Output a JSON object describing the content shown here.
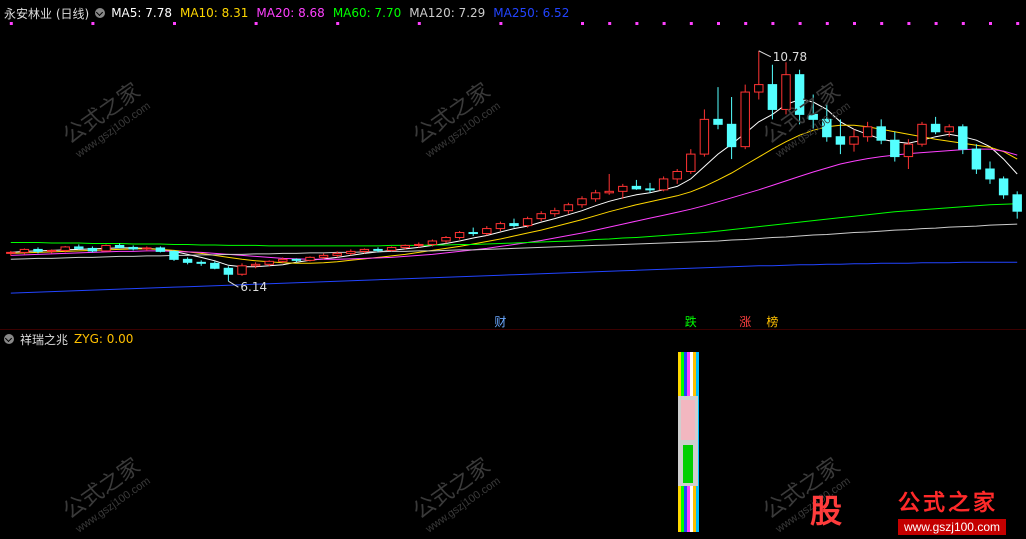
{
  "top_legend": {
    "title": "永安林业 (日线)",
    "items": [
      {
        "label": "MA5: 7.78",
        "color": "#ffffff"
      },
      {
        "label": "MA10: 8.31",
        "color": "#ffd700"
      },
      {
        "label": "MA20: 8.68",
        "color": "#ff40ff"
      },
      {
        "label": "MA60: 7.70",
        "color": "#00ff00"
      },
      {
        "label": "MA120: 7.29",
        "color": "#cccccc"
      },
      {
        "label": "MA250: 6.52",
        "color": "#2244ff"
      }
    ]
  },
  "sub_legend": {
    "title": "祥瑞之兆",
    "value_label": "ZYG: 0.00",
    "value_color": "#ffc000"
  },
  "annotations": {
    "high": "10.78",
    "low": "6.14",
    "markers": [
      {
        "text": "财",
        "color": "#6aa8ff"
      },
      {
        "text": "跌",
        "color": "#00ff00"
      },
      {
        "text": "涨",
        "color": "#ff4040"
      },
      {
        "text": "榜",
        "color": "#ffc000"
      }
    ]
  },
  "watermark": {
    "text": "公式之家",
    "url": "www.gszj100.com"
  },
  "logo": {
    "badge": "股",
    "name": "公式之家",
    "url": "www.gszj100.com"
  },
  "colors": {
    "up": "#ff3333",
    "down": "#54ffff"
  },
  "chart_data": {
    "type": "candlestick",
    "ylim": [
      5.6,
      11.2
    ],
    "candles": [
      [
        6.7,
        6.75,
        6.65,
        6.72
      ],
      [
        6.72,
        6.8,
        6.68,
        6.78
      ],
      [
        6.78,
        6.82,
        6.7,
        6.74
      ],
      [
        6.74,
        6.78,
        6.7,
        6.76
      ],
      [
        6.76,
        6.85,
        6.72,
        6.83
      ],
      [
        6.83,
        6.88,
        6.78,
        6.8
      ],
      [
        6.8,
        6.84,
        6.72,
        6.75
      ],
      [
        6.75,
        6.88,
        6.74,
        6.86
      ],
      [
        6.86,
        6.9,
        6.8,
        6.82
      ],
      [
        6.82,
        6.86,
        6.76,
        6.79
      ],
      [
        6.79,
        6.84,
        6.75,
        6.81
      ],
      [
        6.81,
        6.84,
        6.72,
        6.74
      ],
      [
        6.74,
        6.76,
        6.55,
        6.58
      ],
      [
        6.58,
        6.62,
        6.48,
        6.52
      ],
      [
        6.52,
        6.56,
        6.45,
        6.5
      ],
      [
        6.5,
        6.54,
        6.38,
        6.4
      ],
      [
        6.4,
        6.44,
        6.14,
        6.28
      ],
      [
        6.28,
        6.5,
        6.25,
        6.45
      ],
      [
        6.45,
        6.52,
        6.4,
        6.48
      ],
      [
        6.48,
        6.56,
        6.44,
        6.54
      ],
      [
        6.54,
        6.62,
        6.5,
        6.58
      ],
      [
        6.58,
        6.6,
        6.52,
        6.56
      ],
      [
        6.56,
        6.64,
        6.54,
        6.62
      ],
      [
        6.62,
        6.7,
        6.58,
        6.66
      ],
      [
        6.66,
        6.74,
        6.62,
        6.7
      ],
      [
        6.7,
        6.78,
        6.66,
        6.74
      ],
      [
        6.74,
        6.8,
        6.7,
        6.78
      ],
      [
        6.78,
        6.82,
        6.72,
        6.76
      ],
      [
        6.76,
        6.84,
        6.74,
        6.82
      ],
      [
        6.82,
        6.88,
        6.78,
        6.86
      ],
      [
        6.86,
        6.92,
        6.82,
        6.88
      ],
      [
        6.88,
        6.98,
        6.84,
        6.95
      ],
      [
        6.95,
        7.05,
        6.9,
        7.02
      ],
      [
        7.02,
        7.15,
        6.98,
        7.12
      ],
      [
        7.12,
        7.22,
        7.05,
        7.1
      ],
      [
        7.1,
        7.25,
        7.06,
        7.2
      ],
      [
        7.2,
        7.34,
        7.15,
        7.3
      ],
      [
        7.3,
        7.4,
        7.22,
        7.26
      ],
      [
        7.26,
        7.44,
        7.22,
        7.4
      ],
      [
        7.4,
        7.55,
        7.35,
        7.5
      ],
      [
        7.5,
        7.62,
        7.44,
        7.56
      ],
      [
        7.56,
        7.72,
        7.5,
        7.68
      ],
      [
        7.68,
        7.85,
        7.62,
        7.8
      ],
      [
        7.8,
        7.98,
        7.74,
        7.92
      ],
      [
        7.92,
        8.3,
        7.88,
        7.95
      ],
      [
        7.95,
        8.1,
        7.8,
        8.05
      ],
      [
        8.05,
        8.18,
        7.98,
        8.0
      ],
      [
        8.0,
        8.12,
        7.92,
        7.98
      ],
      [
        7.98,
        8.25,
        7.95,
        8.2
      ],
      [
        8.2,
        8.4,
        8.1,
        8.35
      ],
      [
        8.35,
        8.8,
        8.3,
        8.7
      ],
      [
        8.7,
        9.6,
        8.65,
        9.4
      ],
      [
        9.4,
        10.05,
        9.2,
        9.3
      ],
      [
        9.3,
        9.85,
        8.6,
        8.85
      ],
      [
        8.85,
        10.1,
        8.8,
        9.95
      ],
      [
        9.95,
        10.78,
        9.8,
        10.1
      ],
      [
        10.1,
        10.5,
        9.4,
        9.6
      ],
      [
        9.6,
        10.55,
        9.5,
        10.3
      ],
      [
        10.3,
        10.4,
        9.3,
        9.5
      ],
      [
        9.5,
        9.9,
        9.2,
        9.4
      ],
      [
        9.4,
        9.7,
        8.95,
        9.05
      ],
      [
        9.05,
        9.4,
        8.7,
        8.9
      ],
      [
        8.9,
        9.2,
        8.75,
        9.05
      ],
      [
        9.05,
        9.35,
        8.95,
        9.25
      ],
      [
        9.25,
        9.4,
        8.9,
        8.98
      ],
      [
        8.98,
        9.15,
        8.55,
        8.65
      ],
      [
        8.65,
        9.0,
        8.4,
        8.9
      ],
      [
        8.9,
        9.35,
        8.85,
        9.3
      ],
      [
        9.3,
        9.45,
        9.1,
        9.15
      ],
      [
        9.15,
        9.3,
        9.05,
        9.25
      ],
      [
        9.25,
        9.3,
        8.7,
        8.8
      ],
      [
        8.8,
        8.9,
        8.3,
        8.4
      ],
      [
        8.4,
        8.55,
        8.1,
        8.2
      ],
      [
        8.2,
        8.25,
        7.8,
        7.88
      ],
      [
        7.88,
        7.95,
        7.4,
        7.55
      ]
    ],
    "series": [
      {
        "name": "MA5",
        "color": "#ffffff",
        "values": [
          6.72,
          6.74,
          6.75,
          6.76,
          6.77,
          6.78,
          6.79,
          6.8,
          6.81,
          6.81,
          6.8,
          6.78,
          6.74,
          6.68,
          6.62,
          6.55,
          6.46,
          6.43,
          6.43,
          6.45,
          6.47,
          6.52,
          6.56,
          6.59,
          6.62,
          6.66,
          6.7,
          6.73,
          6.76,
          6.79,
          6.82,
          6.86,
          6.9,
          6.95,
          7.01,
          7.06,
          7.13,
          7.2,
          7.25,
          7.33,
          7.4,
          7.48,
          7.56,
          7.66,
          7.75,
          7.82,
          7.88,
          7.92,
          7.98,
          8.05,
          8.2,
          8.45,
          8.7,
          8.9,
          9.12,
          9.35,
          9.5,
          9.7,
          9.8,
          9.75,
          9.6,
          9.35,
          9.2,
          9.1,
          9.0,
          8.95,
          8.92,
          8.98,
          9.05,
          9.1,
          9.05,
          8.98,
          8.85,
          8.6,
          8.3
        ]
      },
      {
        "name": "MA10",
        "color": "#ffd700",
        "values": [
          6.7,
          6.71,
          6.72,
          6.73,
          6.74,
          6.75,
          6.76,
          6.77,
          6.78,
          6.79,
          6.79,
          6.78,
          6.76,
          6.73,
          6.7,
          6.66,
          6.62,
          6.58,
          6.55,
          6.53,
          6.51,
          6.5,
          6.5,
          6.51,
          6.53,
          6.56,
          6.59,
          6.62,
          6.65,
          6.68,
          6.72,
          6.76,
          6.8,
          6.84,
          6.89,
          6.94,
          6.99,
          7.05,
          7.11,
          7.17,
          7.24,
          7.31,
          7.38,
          7.46,
          7.54,
          7.61,
          7.68,
          7.74,
          7.8,
          7.86,
          7.94,
          8.05,
          8.18,
          8.32,
          8.48,
          8.64,
          8.8,
          8.95,
          9.08,
          9.18,
          9.25,
          9.28,
          9.28,
          9.25,
          9.2,
          9.15,
          9.1,
          9.05,
          9.0,
          8.96,
          8.92,
          8.88,
          8.84,
          8.75,
          8.6
        ]
      },
      {
        "name": "MA20",
        "color": "#ff40ff",
        "values": [
          6.66,
          6.67,
          6.68,
          6.69,
          6.7,
          6.71,
          6.72,
          6.73,
          6.74,
          6.74,
          6.75,
          6.75,
          6.74,
          6.73,
          6.72,
          6.7,
          6.68,
          6.66,
          6.64,
          6.62,
          6.6,
          6.59,
          6.58,
          6.58,
          6.58,
          6.59,
          6.6,
          6.61,
          6.62,
          6.64,
          6.66,
          6.68,
          6.71,
          6.74,
          6.77,
          6.8,
          6.84,
          6.88,
          6.92,
          6.96,
          7.01,
          7.06,
          7.11,
          7.17,
          7.23,
          7.29,
          7.35,
          7.41,
          7.47,
          7.53,
          7.59,
          7.66,
          7.74,
          7.82,
          7.9,
          7.98,
          8.07,
          8.16,
          8.25,
          8.34,
          8.42,
          8.5,
          8.56,
          8.61,
          8.65,
          8.68,
          8.71,
          8.73,
          8.75,
          8.77,
          8.79,
          8.8,
          8.8,
          8.76,
          8.68
        ]
      },
      {
        "name": "MA60",
        "color": "#00ff00",
        "values": [
          6.92,
          6.92,
          6.92,
          6.91,
          6.91,
          6.91,
          6.9,
          6.9,
          6.9,
          6.89,
          6.89,
          6.89,
          6.88,
          6.88,
          6.87,
          6.87,
          6.86,
          6.86,
          6.86,
          6.85,
          6.85,
          6.85,
          6.85,
          6.85,
          6.85,
          6.85,
          6.85,
          6.85,
          6.86,
          6.86,
          6.86,
          6.87,
          6.87,
          6.88,
          6.88,
          6.89,
          6.9,
          6.91,
          6.92,
          6.93,
          6.94,
          6.95,
          6.96,
          6.98,
          6.99,
          7.01,
          7.02,
          7.04,
          7.06,
          7.08,
          7.1,
          7.12,
          7.15,
          7.18,
          7.21,
          7.24,
          7.27,
          7.3,
          7.33,
          7.36,
          7.39,
          7.42,
          7.45,
          7.48,
          7.51,
          7.54,
          7.56,
          7.58,
          7.6,
          7.62,
          7.64,
          7.66,
          7.68,
          7.69,
          7.7
        ]
      },
      {
        "name": "MA120",
        "color": "#cccccc",
        "values": [
          6.58,
          6.59,
          6.6,
          6.6,
          6.61,
          6.62,
          6.62,
          6.63,
          6.64,
          6.64,
          6.65,
          6.65,
          6.66,
          6.66,
          6.67,
          6.67,
          6.68,
          6.68,
          6.69,
          6.69,
          6.7,
          6.7,
          6.71,
          6.71,
          6.72,
          6.72,
          6.73,
          6.73,
          6.74,
          6.74,
          6.75,
          6.75,
          6.76,
          6.77,
          6.77,
          6.78,
          6.79,
          6.8,
          6.81,
          6.82,
          6.83,
          6.84,
          6.85,
          6.86,
          6.87,
          6.88,
          6.89,
          6.9,
          6.91,
          6.92,
          6.93,
          6.94,
          6.95,
          6.97,
          6.98,
          7.0,
          7.02,
          7.03,
          7.05,
          7.07,
          7.08,
          7.1,
          7.12,
          7.13,
          7.15,
          7.17,
          7.18,
          7.2,
          7.21,
          7.23,
          7.24,
          7.25,
          7.27,
          7.28,
          7.29
        ]
      },
      {
        "name": "MA250",
        "color": "#2244ff",
        "values": [
          5.9,
          5.91,
          5.92,
          5.93,
          5.94,
          5.95,
          5.96,
          5.97,
          5.98,
          5.99,
          6.0,
          6.01,
          6.02,
          6.03,
          6.04,
          6.05,
          6.06,
          6.07,
          6.08,
          6.09,
          6.1,
          6.11,
          6.12,
          6.13,
          6.14,
          6.15,
          6.16,
          6.17,
          6.18,
          6.19,
          6.2,
          6.21,
          6.22,
          6.23,
          6.24,
          6.25,
          6.26,
          6.27,
          6.28,
          6.29,
          6.3,
          6.31,
          6.32,
          6.33,
          6.34,
          6.35,
          6.36,
          6.37,
          6.38,
          6.39,
          6.4,
          6.41,
          6.42,
          6.43,
          6.44,
          6.45,
          6.45,
          6.46,
          6.47,
          6.47,
          6.48,
          6.48,
          6.49,
          6.49,
          6.5,
          6.5,
          6.5,
          6.51,
          6.51,
          6.51,
          6.52,
          6.52,
          6.52,
          6.52,
          6.52
        ]
      }
    ]
  }
}
